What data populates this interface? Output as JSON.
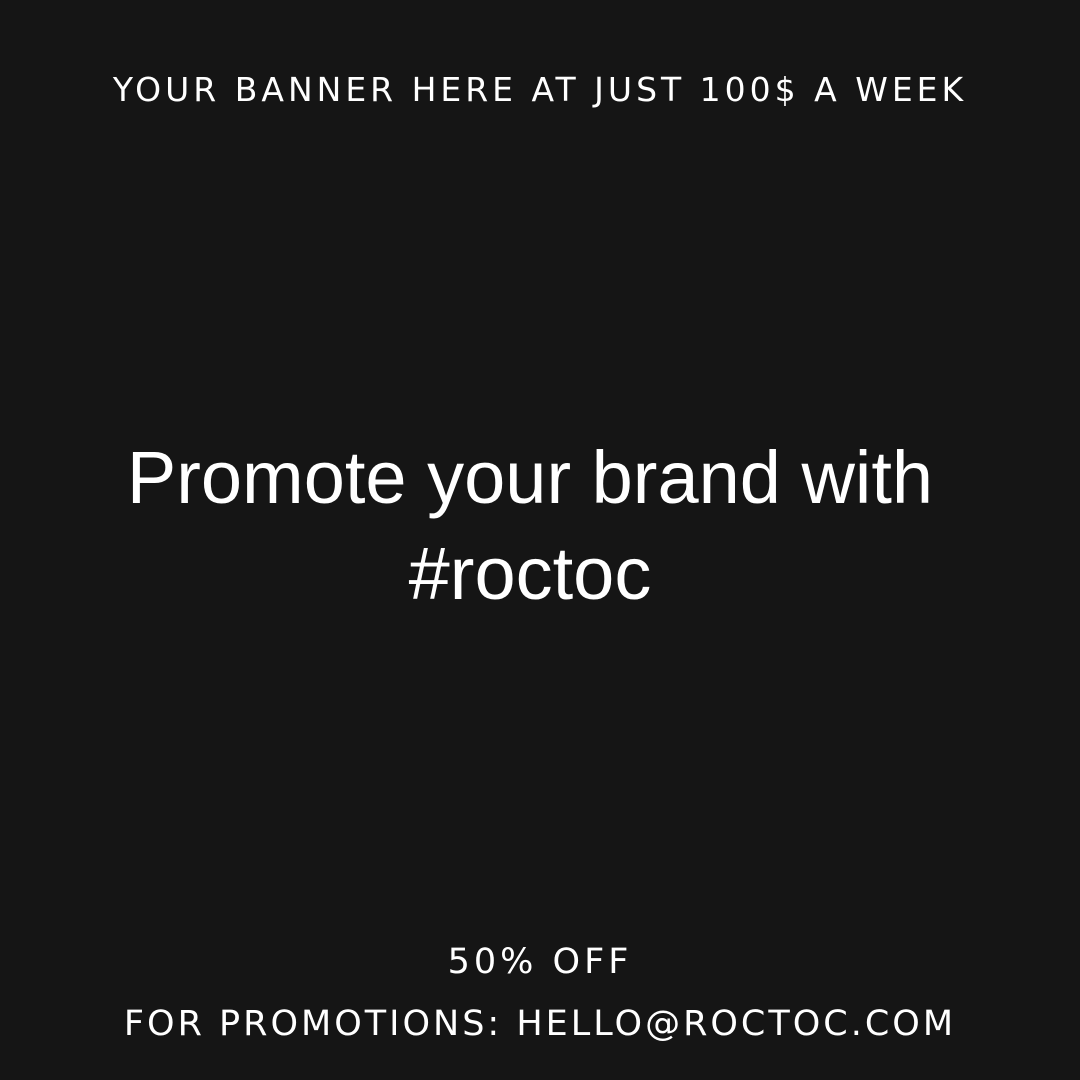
{
  "banner": {
    "top_text": "YOUR BANNER HERE AT JUST 100$ A WEEK",
    "headline_line1": "Promote your brand with",
    "headline_line2": "#roctoc",
    "discount_text": "50% OFF",
    "contact_text": "FOR PROMOTIONS: HELLO@ROCTOC.COM"
  },
  "colors": {
    "background": "#151515",
    "text": "#ffffff"
  }
}
